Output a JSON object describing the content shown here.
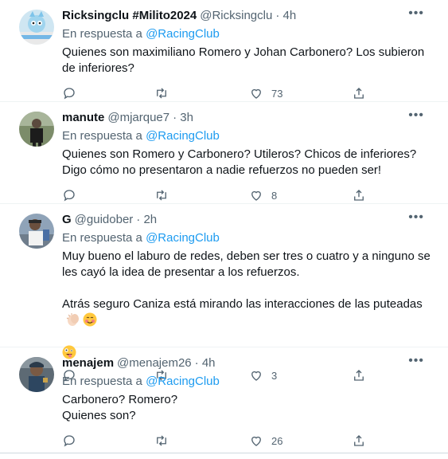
{
  "tweets": [
    {
      "name": "Ricksingclu #Milito2024",
      "handle": "@Ricksingclu",
      "time": "· 4h",
      "reply_prefix": "En respuesta a",
      "reply_to": "@RacingClub",
      "text": "Quienes son maximiliano Romero y Johan Carbonero? Los subieron de inferiores?",
      "likes": "73"
    },
    {
      "name": "manute",
      "handle": "@mjarque7",
      "time": "· 3h",
      "reply_prefix": "En respuesta a",
      "reply_to": "@RacingClub",
      "text": "Quienes son Romero y Carbonero? Utileros? Chicos de inferiores? Digo cómo no presentaron a nadie refuerzos no pueden ser!",
      "likes": "8"
    },
    {
      "name": "G",
      "handle": "@guidober",
      "time": "· 2h",
      "reply_prefix": "En respuesta a",
      "reply_to": "@RacingClub",
      "text": "Muy bueno el laburo de redes, deben ser tres o cuatro y a ninguno se les cayó la idea de presentar a los refuerzos.",
      "text2": "Atrás seguro Caniza está mirando las interacciones de las puteadas",
      "likes": "3"
    },
    {
      "name": "menajem",
      "handle": "@menajem26",
      "time": "· 4h",
      "reply_prefix": "En respuesta a",
      "reply_to": "@RacingClub",
      "text": "Carbonero? Romero?\nQuienes son?",
      "likes": "26"
    }
  ],
  "more_glyph": "•••",
  "colors": {
    "link": "#1d9bf0",
    "secondary": "#536471",
    "divider": "#eff3f4"
  },
  "icons": [
    "reply-icon",
    "retweet-icon",
    "like-icon",
    "share-icon",
    "more-icon"
  ]
}
